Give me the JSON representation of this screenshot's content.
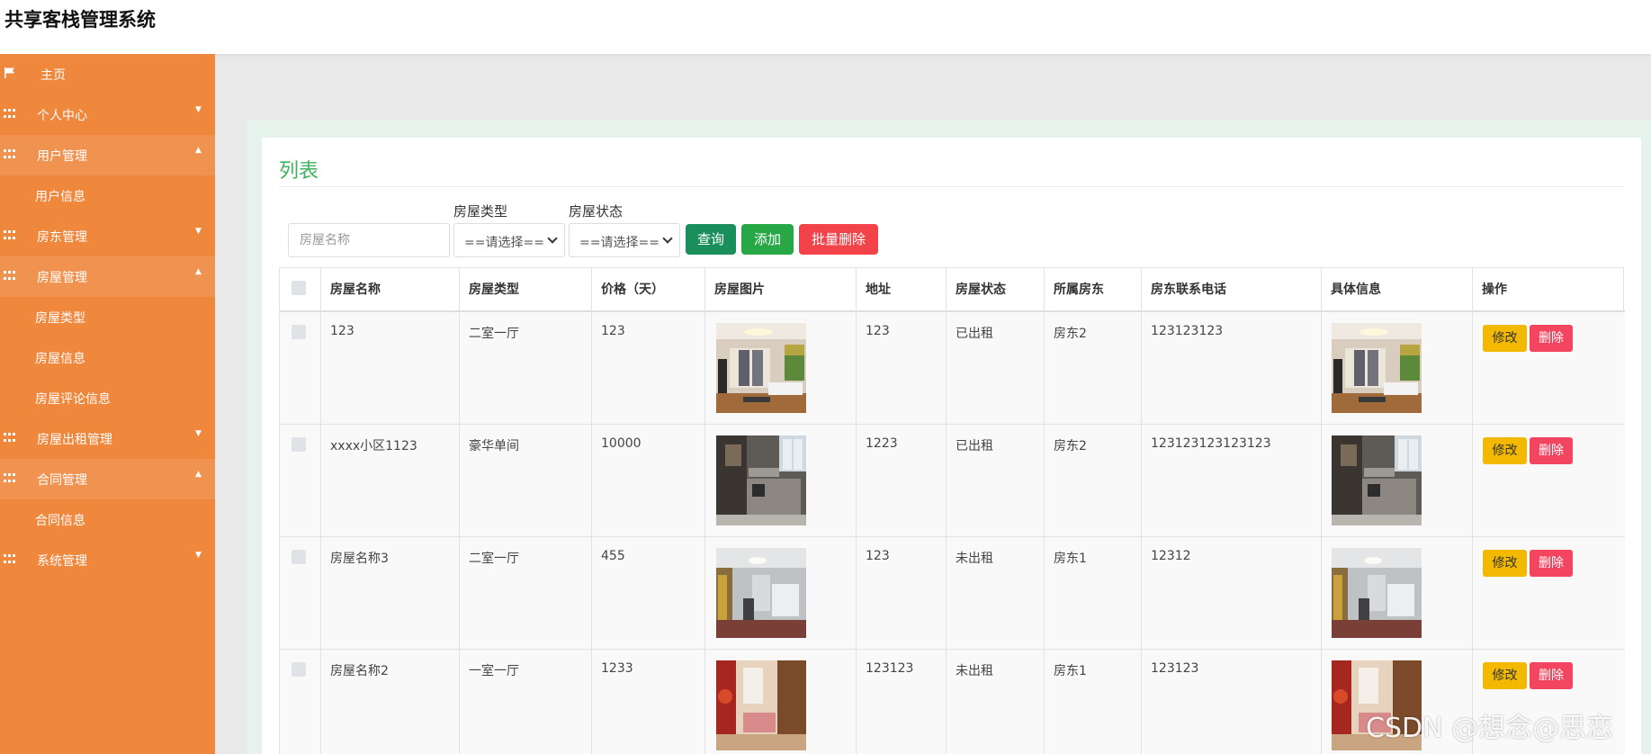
{
  "app": {
    "title": "共享客栈管理系统"
  },
  "sidebar": {
    "items": [
      {
        "label": "主页"
      },
      {
        "label": "个人中心"
      },
      {
        "label": "用户管理"
      },
      {
        "label": "用户信息"
      },
      {
        "label": "房东管理"
      },
      {
        "label": "房屋管理"
      },
      {
        "label": "房屋类型"
      },
      {
        "label": "房屋信息"
      },
      {
        "label": "房屋评论信息"
      },
      {
        "label": "房屋出租管理"
      },
      {
        "label": "合同管理"
      },
      {
        "label": "合同信息"
      },
      {
        "label": "系统管理"
      }
    ]
  },
  "main": {
    "title": "列表",
    "search": {
      "name_placeholder": "房屋名称",
      "type_label": "房屋类型",
      "type_value": "==请选择==",
      "status_label": "房屋状态",
      "status_value": "==请选择=="
    },
    "buttons": {
      "query": "查询",
      "add": "添加",
      "batch_delete": "批量删除"
    },
    "table": {
      "columns": [
        "房屋名称",
        "房屋类型",
        "价格（天）",
        "房屋图片",
        "地址",
        "房屋状态",
        "所属房东",
        "房东联系电话",
        "具体信息",
        "操作"
      ],
      "rows": [
        {
          "name": "123",
          "type": "二室一厅",
          "price": "123",
          "address": "123",
          "status": "已出租",
          "landlord": "房东2",
          "phone": "123123123",
          "edit": "修改",
          "delete": "删除"
        },
        {
          "name": "xxxx小区1123",
          "type": "豪华单间",
          "price": "10000",
          "address": "1223",
          "status": "已出租",
          "landlord": "房东2",
          "phone": "123123123123123",
          "edit": "修改",
          "delete": "删除"
        },
        {
          "name": "房屋名称3",
          "type": "二室一厅",
          "price": "455",
          "address": "123",
          "status": "未出租",
          "landlord": "房东1",
          "phone": "12312",
          "edit": "修改",
          "delete": "删除"
        },
        {
          "name": "房屋名称2",
          "type": "一室一厅",
          "price": "1233",
          "address": "123123",
          "status": "未出租",
          "landlord": "房东1",
          "phone": "123123",
          "edit": "修改",
          "delete": "删除"
        }
      ]
    }
  },
  "watermark": "CSDN @想念@思恋",
  "colors": {
    "sidebar": "#ef873c",
    "accent_title": "#3cb45e",
    "query": "#1a8f5c",
    "add": "#27a745",
    "danger": "#f2434a",
    "edit": "#f2b900"
  }
}
